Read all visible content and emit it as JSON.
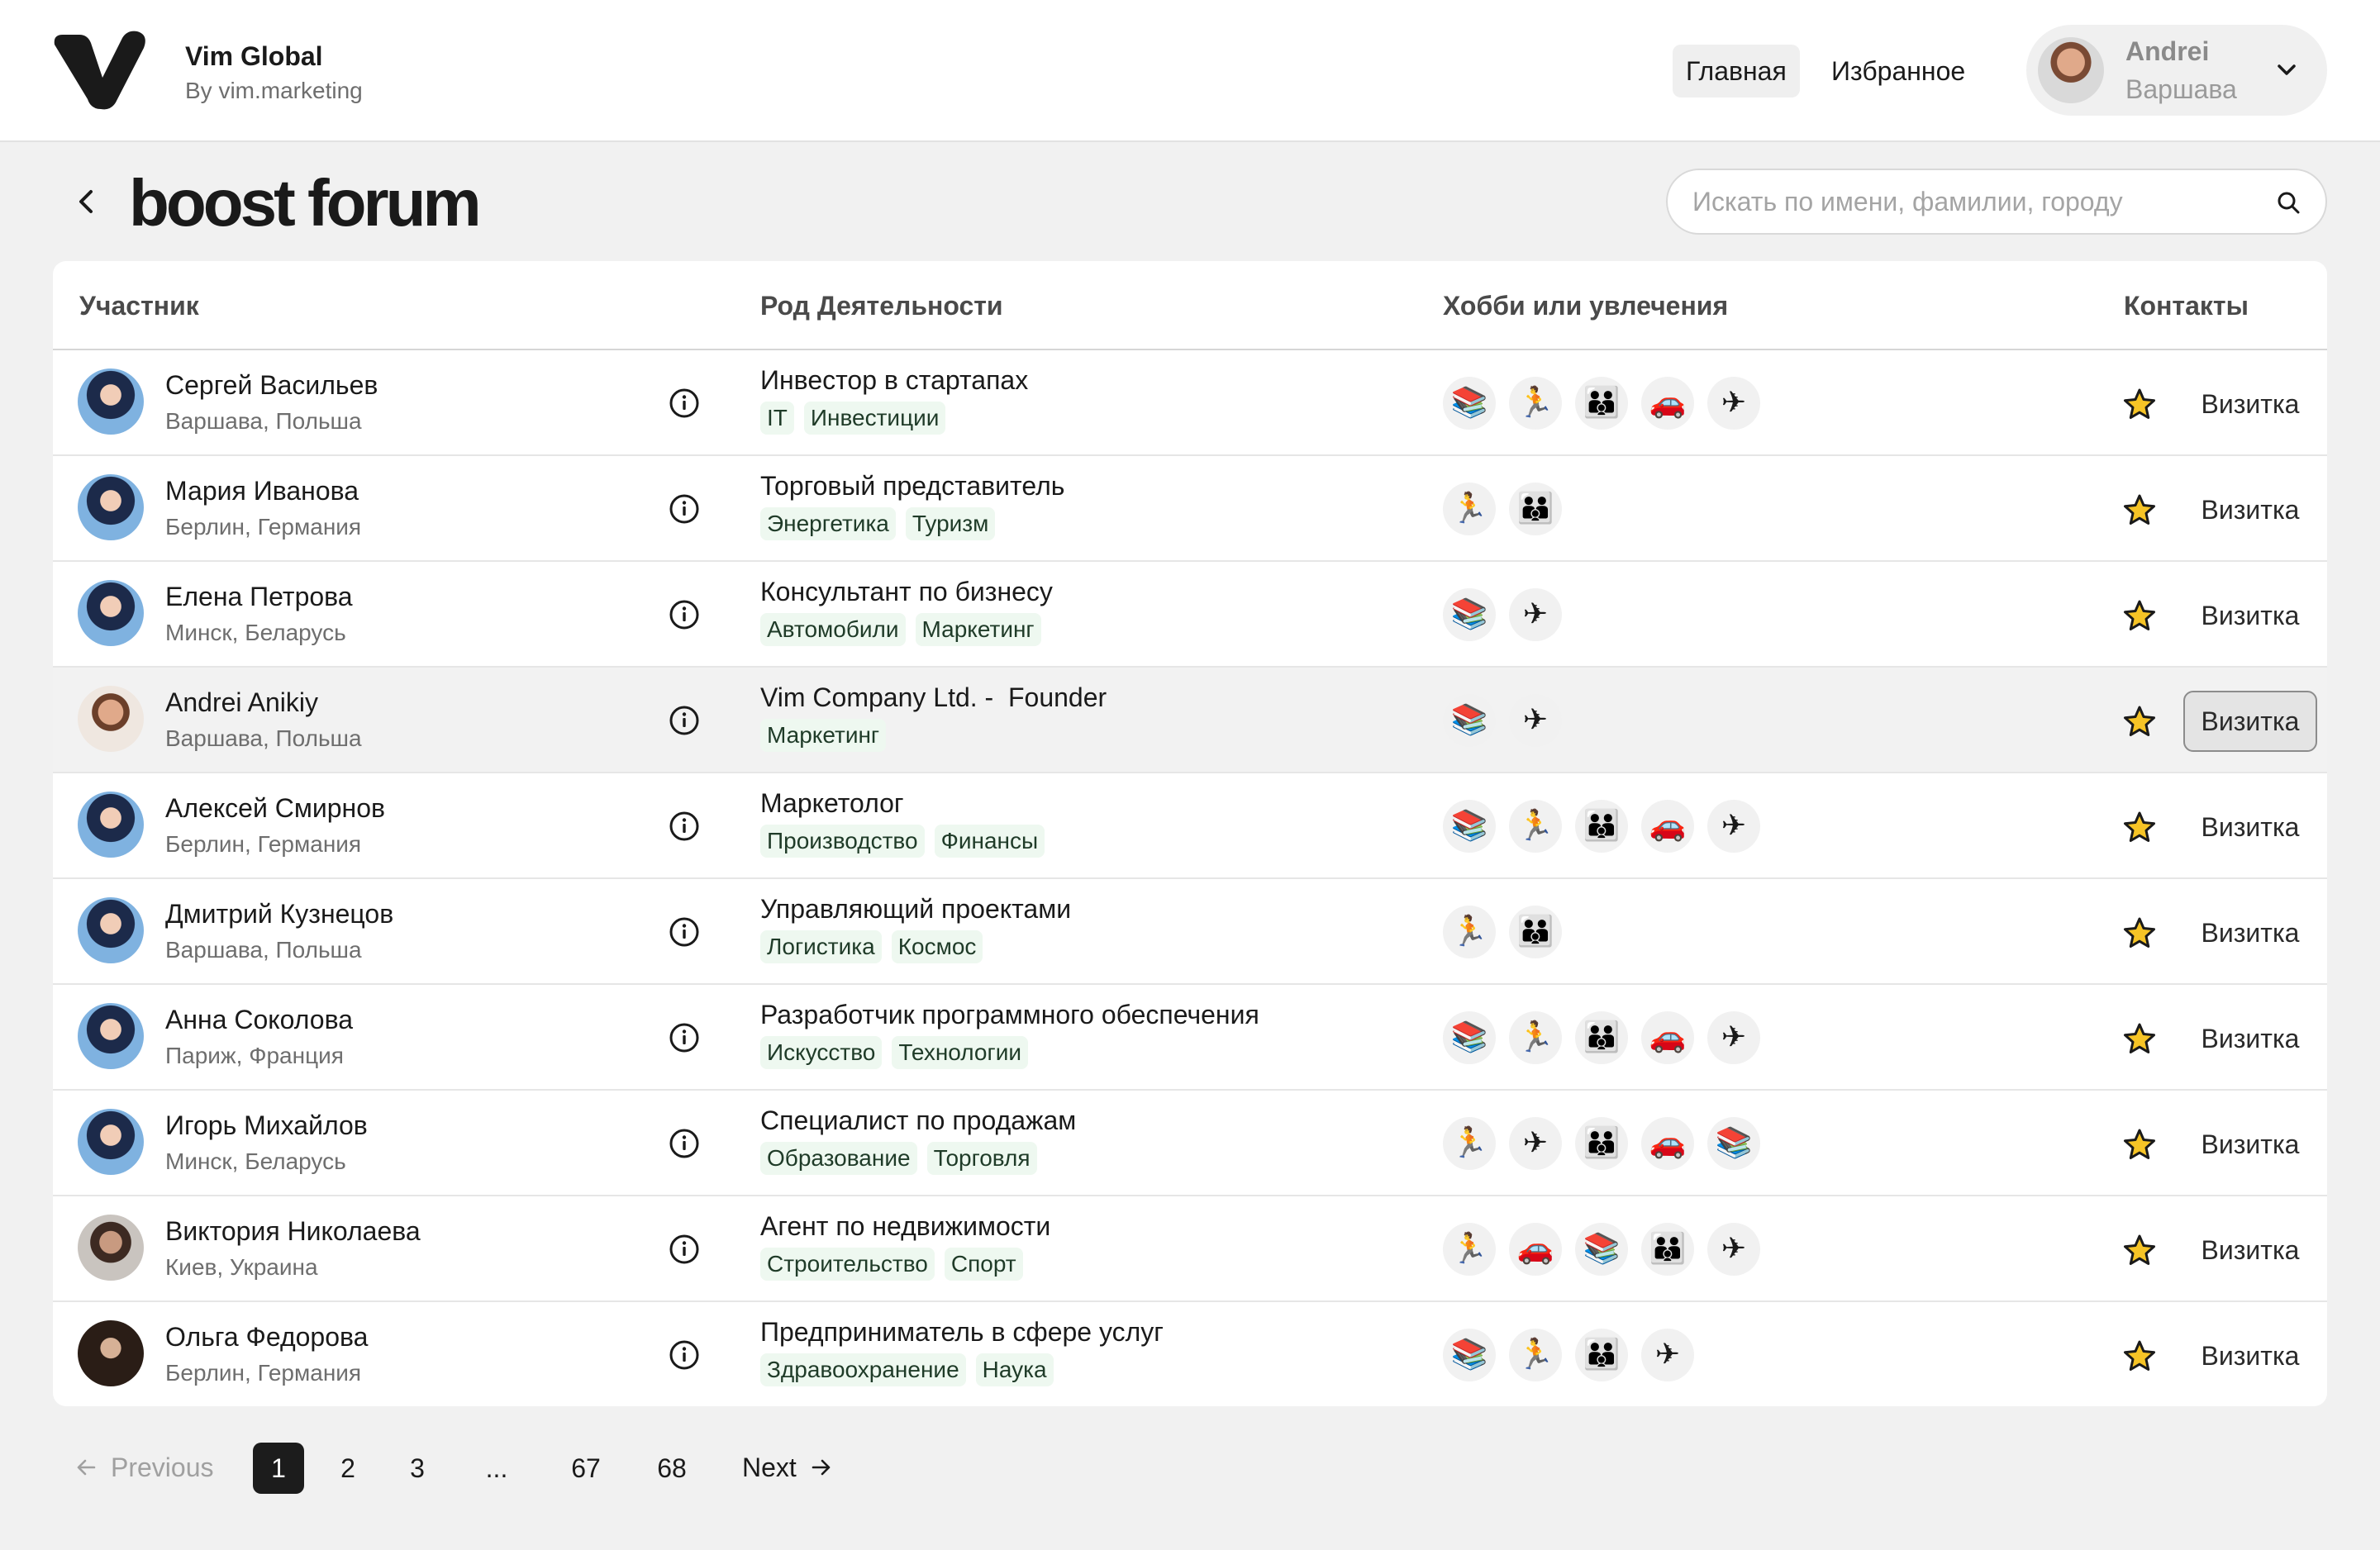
{
  "header": {
    "brand_name": "Vim Global",
    "brand_sub": "By vim.marketing",
    "nav_home": "Главная",
    "nav_favorites": "Избранное",
    "user_name": "Andrei",
    "user_city": "Варшава"
  },
  "page": {
    "title": "boost forum",
    "search_placeholder": "Искать по имени, фамилии, городу"
  },
  "table": {
    "columns": {
      "participant": "Участник",
      "occupation": "Род Деятельности",
      "hobbies": "Хобби или увлечения",
      "contacts": "Контакты"
    },
    "vcard_label": "Визитка",
    "rows": [
      {
        "name": "Сергей Васильев",
        "city": "Варшава, Польша",
        "job": "Инвестор в стартапах",
        "tags": [
          "IT",
          "Инвестиции"
        ],
        "hobbies": [
          "books",
          "running",
          "family",
          "car",
          "plane"
        ],
        "avatar": "girl"
      },
      {
        "name": "Мария Иванова",
        "city": "Берлин, Германия",
        "job": "Торговый представитель",
        "tags": [
          "Энергетика",
          "Туризм"
        ],
        "hobbies": [
          "running",
          "family"
        ],
        "avatar": "girl"
      },
      {
        "name": "Елена Петрова",
        "city": "Минск, Беларусь",
        "job": "Консультант по бизнесу",
        "tags": [
          "Автомобили",
          "Маркетинг"
        ],
        "hobbies": [
          "books",
          "plane"
        ],
        "avatar": "girl"
      },
      {
        "name": "Andrei Anikiy",
        "city": "Варшава, Польша",
        "job": "Vim Company Ltd. -  Founder",
        "tags": [
          "Маркетинг"
        ],
        "hobbies": [
          "books",
          "plane"
        ],
        "avatar": "andrei",
        "highlight": true
      },
      {
        "name": "Алексей Смирнов",
        "city": "Берлин, Германия",
        "job": "Маркетолог",
        "tags": [
          "Производство",
          "Финансы"
        ],
        "hobbies": [
          "books",
          "running",
          "family",
          "car",
          "plane"
        ],
        "avatar": "girl"
      },
      {
        "name": "Дмитрий Кузнецов",
        "city": "Варшава, Польша",
        "job": "Управляющий проектами",
        "tags": [
          "Логистика",
          "Космос"
        ],
        "hobbies": [
          "running",
          "family"
        ],
        "avatar": "girl"
      },
      {
        "name": "Анна Соколова",
        "city": "Париж, Франция",
        "job": "Разработчик программного обеспечения",
        "tags": [
          "Искусство",
          "Технологии"
        ],
        "hobbies": [
          "books",
          "running",
          "family",
          "car",
          "plane"
        ],
        "avatar": "girl"
      },
      {
        "name": "Игорь Михайлов",
        "city": "Минск, Беларусь",
        "job": "Специалист по продажам",
        "tags": [
          "Образование",
          "Торговля"
        ],
        "hobbies": [
          "running",
          "plane",
          "family",
          "car",
          "books"
        ],
        "avatar": "girl"
      },
      {
        "name": "Виктория Николаева",
        "city": "Киев, Украина",
        "job": "Агент по недвижимости",
        "tags": [
          "Строительство",
          "Спорт"
        ],
        "hobbies": [
          "running",
          "car",
          "books",
          "family",
          "plane"
        ],
        "avatar": "beard"
      },
      {
        "name": "Ольга Федорова",
        "city": "Берлин, Германия",
        "job": "Предприниматель в сфере услуг",
        "tags": [
          "Здравоохранение",
          "Наука"
        ],
        "hobbies": [
          "books",
          "running",
          "family",
          "plane"
        ],
        "avatar": "dark"
      }
    ]
  },
  "pagination": {
    "previous": "Previous",
    "next": "Next",
    "pages": [
      "1",
      "2",
      "3",
      "...",
      "67",
      "68"
    ],
    "current": "1"
  },
  "icons": {
    "books": "📚",
    "running": "🏃",
    "family": "👪",
    "car": "🚗",
    "plane": "✈"
  },
  "colors": {
    "tag_bg": "#eef8f0",
    "star": "#f6c426",
    "current_page_bg": "#1c1c1c"
  }
}
